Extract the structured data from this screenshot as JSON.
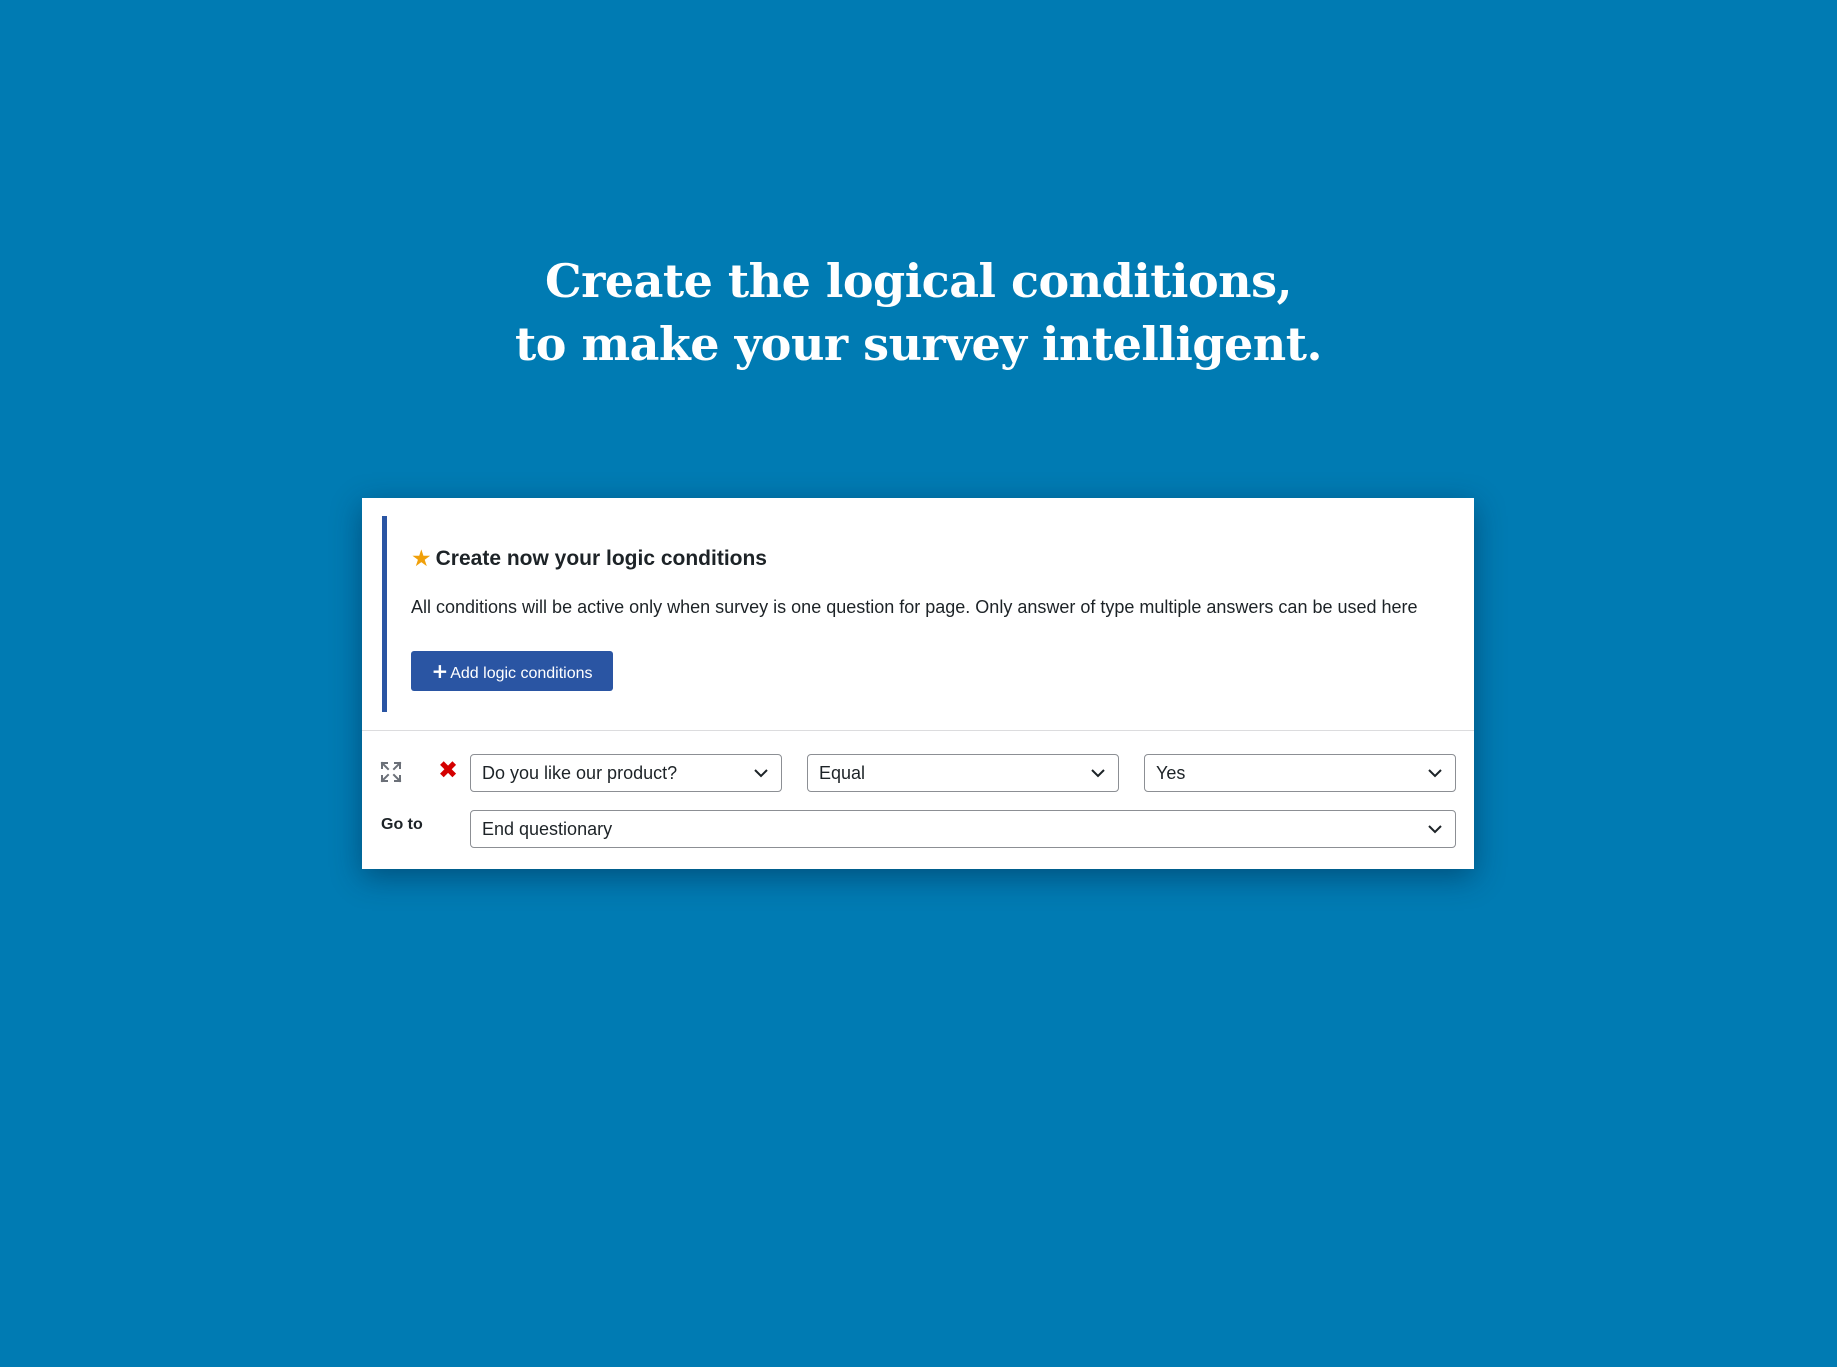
{
  "hero": {
    "line1": "Create the logical conditions,",
    "line2": "to make your survey intelligent."
  },
  "notice": {
    "title": "Create now your logic conditions",
    "description": "All conditions will be active only when survey is one question for page. Only answer of type multiple answers can be used here",
    "add_button_label": "Add logic conditions"
  },
  "condition": {
    "question": "Do you like our product?",
    "operator": "Equal",
    "answer": "Yes"
  },
  "goto": {
    "label": "Go to",
    "target": "End questionary"
  },
  "icons": {
    "star": "star-icon",
    "plus": "plus-icon",
    "expand": "expand-icon",
    "remove": "remove-icon",
    "chevron": "chevron-down-icon"
  },
  "colors": {
    "background": "#007bb3",
    "accent": "#2a55a3",
    "star": "#f0a00a",
    "remove": "#d40000"
  }
}
